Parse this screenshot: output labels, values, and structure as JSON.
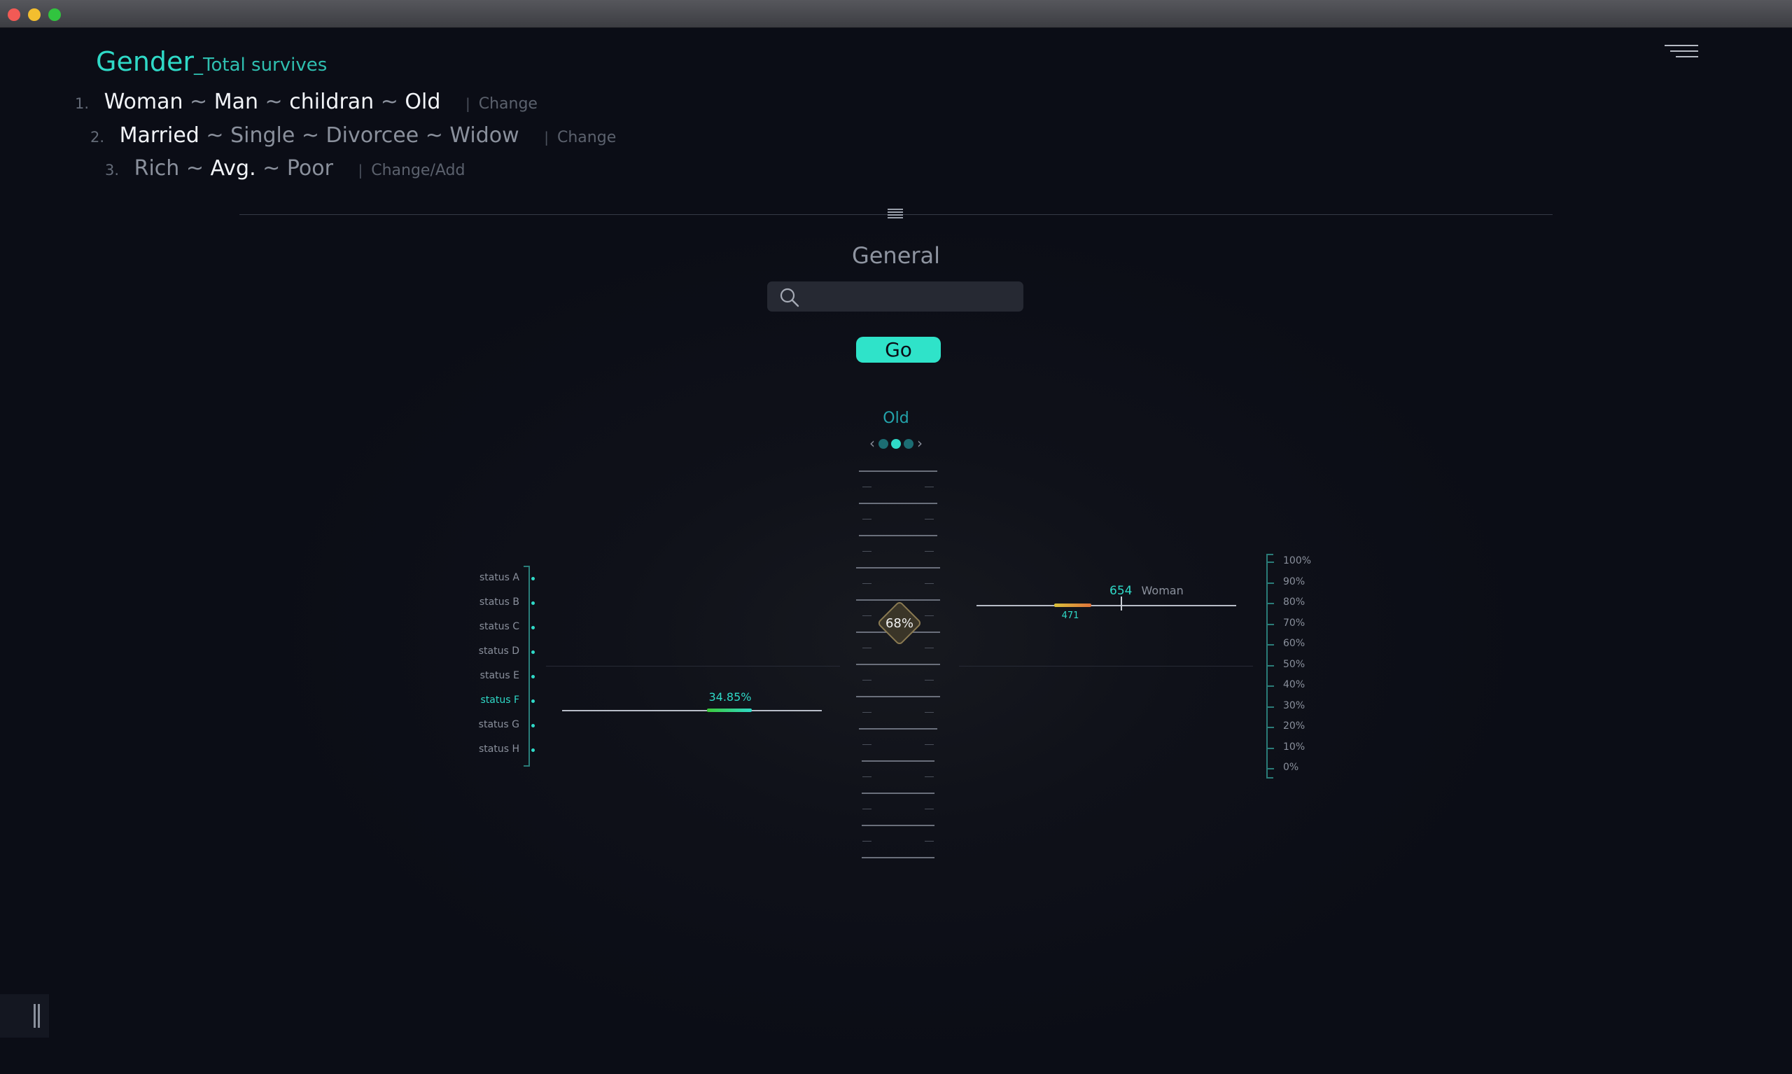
{
  "header": {
    "title": "Gender",
    "subtitle": "_Total survives"
  },
  "categories": [
    {
      "number": "1.",
      "items": [
        "Woman",
        "Man",
        "childran",
        "Old"
      ],
      "separator": "~",
      "change_label": "Change"
    },
    {
      "number": "2.",
      "items": [
        "Married",
        "Single",
        "Divorcee",
        "Widow"
      ],
      "separator": "~",
      "change_label": "Change"
    },
    {
      "number": "3.",
      "items": [
        "Rich",
        "Avg.",
        "Poor"
      ],
      "separator": "~",
      "change_label": "Change/Add"
    }
  ],
  "main": {
    "section_title": "General",
    "search": {
      "placeholder": "",
      "value": ""
    },
    "go_label": "Go",
    "selector_label": "Old",
    "selector_pages": 3,
    "selector_active": 1
  },
  "gauge": {
    "value_label": "68%"
  },
  "status_chart": {
    "labels": [
      "status A",
      "status B",
      "status C",
      "status D",
      "status E",
      "status F",
      "status G",
      "status H"
    ],
    "active": "status F",
    "value_label": "34.85%"
  },
  "woman_chart": {
    "value": "654",
    "label": "Woman",
    "sub_value": "471"
  },
  "percent_axis": [
    "100%",
    "90%",
    "80%",
    "70%",
    "60%",
    "50%",
    "40%",
    "30%",
    "20%",
    "10%",
    "0%"
  ],
  "colors": {
    "accent": "#2fd9c7",
    "button": "#2fe3c9",
    "background": "#0b0d16",
    "axis": "#2a7c78",
    "warn": "#e0733a"
  },
  "icons": {
    "menu": "hamburger-menu-icon",
    "search": "search-icon",
    "handle": "drag-handle-icon"
  }
}
